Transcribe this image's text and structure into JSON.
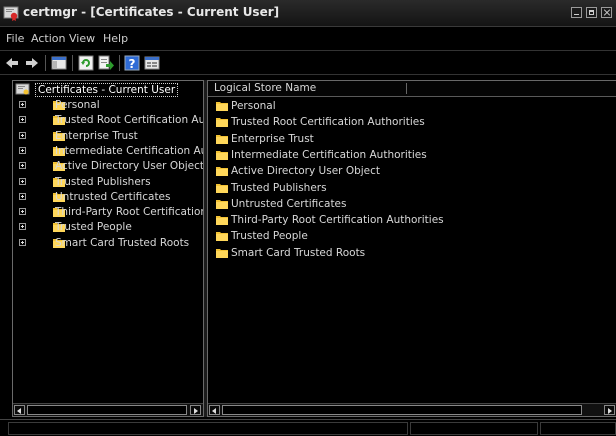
{
  "window": {
    "title": "certmgr - [Certificates - Current User]"
  },
  "menu": [
    "File",
    "Action",
    "View",
    "Help"
  ],
  "toolbar": {
    "icons": [
      "back-arrow-icon",
      "forward-arrow-icon",
      "show-hide-tree-icon",
      "refresh-icon",
      "export-list-icon",
      "help-icon",
      "properties-icon"
    ]
  },
  "tree": {
    "root": "Certificates - Current User",
    "items": [
      "Personal",
      "Trusted Root Certification Autho",
      "Enterprise Trust",
      "Intermediate Certification Autho",
      "Active Directory User Object",
      "Trusted Publishers",
      "Untrusted Certificates",
      "Third-Party Root Certification Au",
      "Trusted People",
      "Smart Card Trusted Roots"
    ]
  },
  "list": {
    "column": "Logical Store Name",
    "items": [
      "Personal",
      "Trusted Root Certification Authorities",
      "Enterprise Trust",
      "Intermediate Certification Authorities",
      "Active Directory User Object",
      "Trusted Publishers",
      "Untrusted Certificates",
      "Third-Party Root Certification Authorities",
      "Trusted People",
      "Smart Card Trusted Roots"
    ]
  },
  "colors": {
    "folder": "#f2c233",
    "background": "#000000",
    "text": "#d8d8d8"
  }
}
